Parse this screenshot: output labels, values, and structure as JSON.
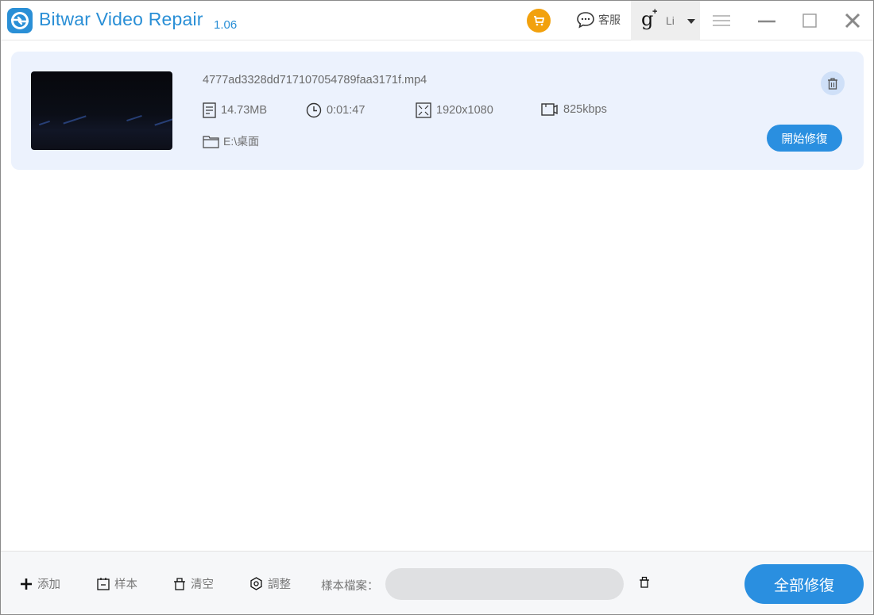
{
  "titlebar": {
    "app_name": "Bitwar Video Repair",
    "version": "1.06",
    "cart_icon": "shopping-cart-icon",
    "support_label": "客服",
    "account_provider_icon": "google-plus-icon",
    "account_user": "Li",
    "menu_icon": "hamburger-menu-icon",
    "minimize_icon": "minimize-icon",
    "maximize_icon": "maximize-icon",
    "close_icon": "close-icon"
  },
  "files": [
    {
      "name": "4777ad3328dd717107054789faa3171f.mp4",
      "size": "14.73MB",
      "duration": "0:01:47",
      "resolution": "1920x1080",
      "bitrate": "825kbps",
      "path": "E:\\桌面",
      "start_repair_label": "開始修復"
    }
  ],
  "bottombar": {
    "add_label": "添加",
    "sample_label": "样本",
    "clear_label": "清空",
    "adjust_label": "調整",
    "sample_file_label": "樣本檔案：",
    "sample_file_value": "",
    "repair_all_label": "全部修復"
  },
  "colors": {
    "accent": "#2a8fe0",
    "title_text": "#2a8fd6",
    "cart": "#f2a10d",
    "card_bg": "#ecf2fd"
  }
}
